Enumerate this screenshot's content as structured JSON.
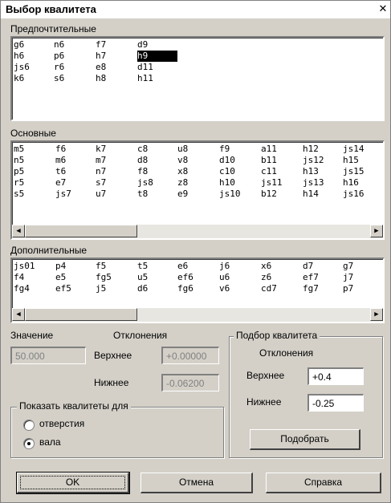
{
  "window": {
    "title": "Выбор квалитета",
    "close_glyph": "✕"
  },
  "preferred": {
    "label": "Предпочтительные",
    "columns": [
      [
        "g6",
        "h6",
        "js6",
        "k6"
      ],
      [
        "n6",
        "p6",
        "r6",
        "s6"
      ],
      [
        "f7",
        "h7",
        "e8",
        "h8"
      ],
      [
        "d9",
        "h9",
        "d11",
        "h11"
      ]
    ],
    "selected": "h9"
  },
  "basic": {
    "label": "Основные",
    "columns": [
      [
        "m5",
        "n5",
        "p5",
        "r5",
        "s5"
      ],
      [
        "f6",
        "m6",
        "t6",
        "e7",
        "js7"
      ],
      [
        "k7",
        "m7",
        "n7",
        "s7",
        "u7"
      ],
      [
        "c8",
        "d8",
        "f8",
        "js8",
        "t8"
      ],
      [
        "u8",
        "v8",
        "x8",
        "z8",
        "e9"
      ],
      [
        "f9",
        "d10",
        "c10",
        "h10",
        "js10"
      ],
      [
        "a11",
        "b11",
        "c11",
        "js11",
        "b12"
      ],
      [
        "h12",
        "js12",
        "h13",
        "js13",
        "h14"
      ],
      [
        "js14",
        "h15",
        "js15",
        "h16",
        "js16"
      ]
    ]
  },
  "additional": {
    "label": "Дополнительные",
    "columns": [
      [
        "js01",
        "f4",
        "fg4"
      ],
      [
        "p4",
        "e5",
        "ef5"
      ],
      [
        "f5",
        "fg5",
        "j5"
      ],
      [
        "t5",
        "u5",
        "d6"
      ],
      [
        "e6",
        "ef6",
        "fg6"
      ],
      [
        "j6",
        "u6",
        "v6"
      ],
      [
        "x6",
        "z6",
        "cd7"
      ],
      [
        "d7",
        "ef7",
        "fg7"
      ],
      [
        "g7",
        "j7",
        "p7"
      ]
    ]
  },
  "value": {
    "label": "Значение",
    "value": "50.000",
    "deviations_label": "Отклонения",
    "upper_label": "Верхнее",
    "upper_value": "+0.00000",
    "lower_label": "Нижнее",
    "lower_value": "-0.06200"
  },
  "show_for": {
    "label": "Показать квалитеты для",
    "options": [
      "отверстия",
      "вала"
    ],
    "selected_index": 1
  },
  "fit": {
    "label": "Подбор квалитета",
    "deviations_label": "Отклонения",
    "upper_label": "Верхнее",
    "upper_value": "+0.4",
    "lower_label": "Нижнее",
    "lower_value": "-0.25",
    "button": "Подобрать"
  },
  "buttons": {
    "ok": "OK",
    "cancel": "Отмена",
    "help": "Справка"
  },
  "scroll": {
    "left_glyph": "◀",
    "right_glyph": "▶"
  }
}
